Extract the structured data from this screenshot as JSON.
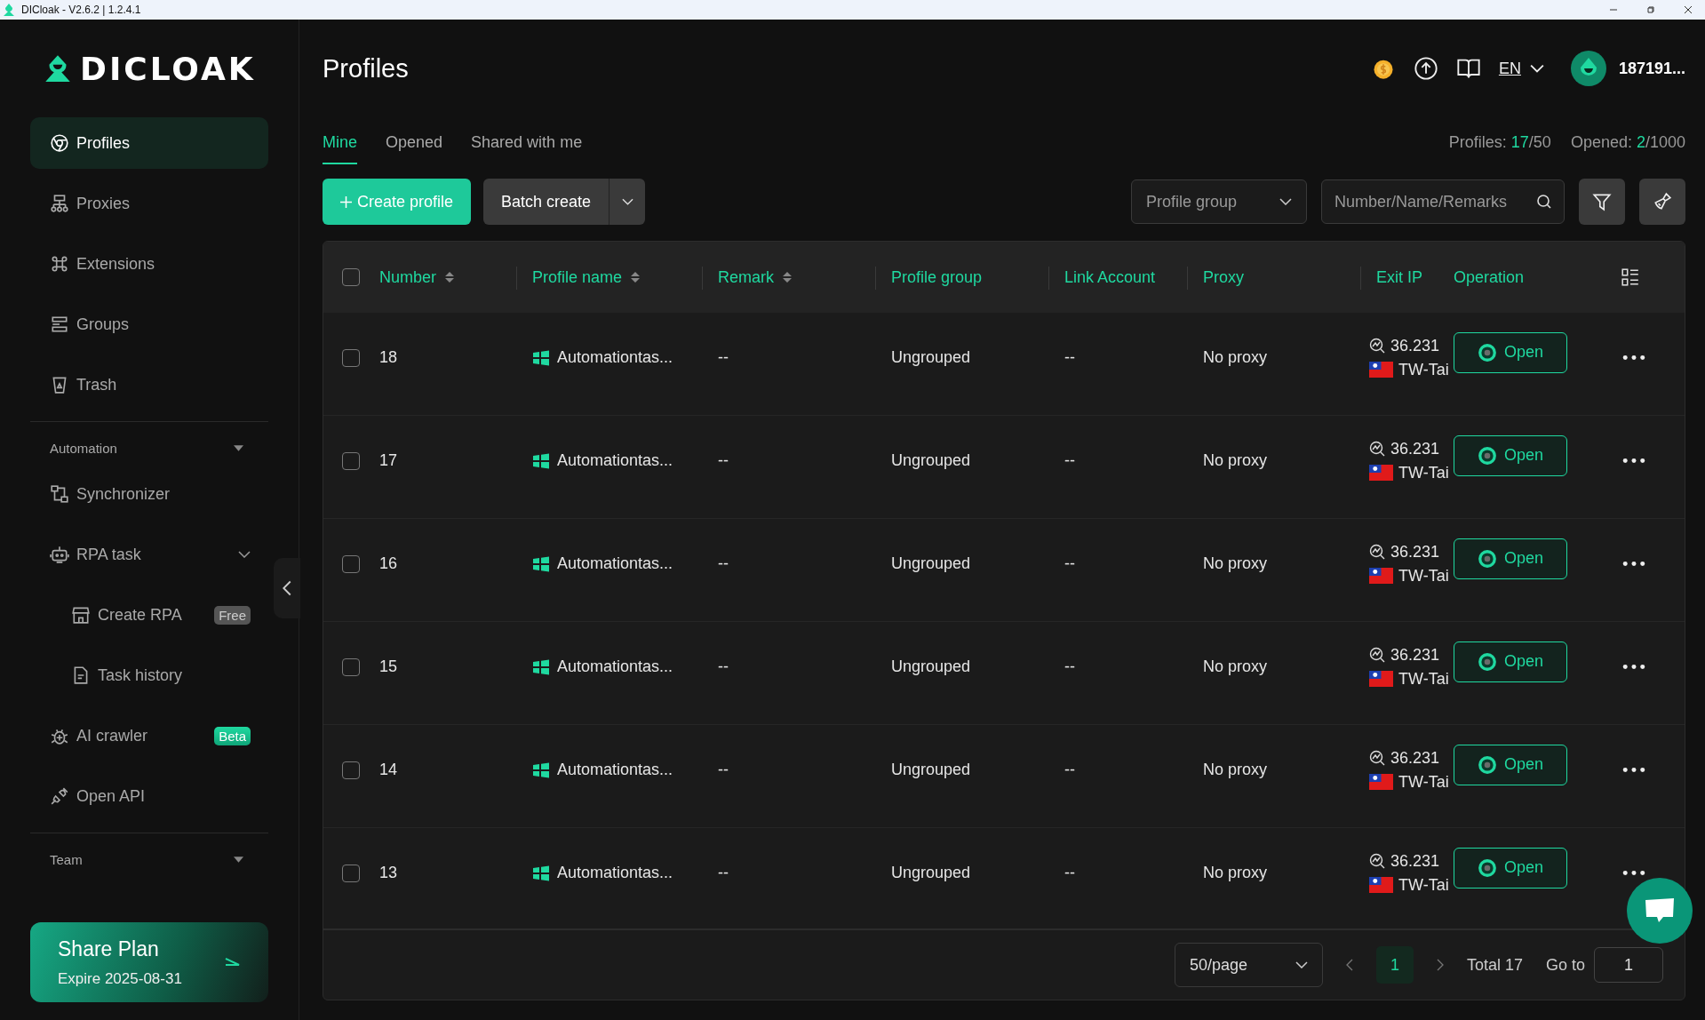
{
  "window": {
    "title": "DICloak - V2.6.2 | 1.2.4.1"
  },
  "sidebar": {
    "logo": "DICLOAK",
    "nav": [
      {
        "label": "Profiles",
        "selected": true
      },
      {
        "label": "Proxies",
        "selected": false
      },
      {
        "label": "Extensions",
        "selected": false
      },
      {
        "label": "Groups",
        "selected": false
      },
      {
        "label": "Trash",
        "selected": false
      }
    ],
    "automation": {
      "heading": "Automation",
      "items": [
        {
          "label": "Synchronizer",
          "kind": "item"
        },
        {
          "label": "RPA task",
          "kind": "group",
          "expanded": true,
          "children": [
            {
              "label": "Create RPA",
              "badge": "Free"
            },
            {
              "label": "Task history"
            }
          ]
        },
        {
          "label": "AI crawler",
          "kind": "item",
          "badge": "Beta"
        },
        {
          "label": "Open API",
          "kind": "item"
        }
      ]
    },
    "team": {
      "heading": "Team"
    },
    "plan": {
      "title": "Share Plan",
      "expire": "Expire 2025-08-31"
    }
  },
  "header": {
    "title": "Profiles",
    "language": "EN",
    "user": "187191..."
  },
  "tabs": [
    {
      "label": "Mine",
      "selected": true
    },
    {
      "label": "Opened",
      "selected": false
    },
    {
      "label": "Shared with me",
      "selected": false
    }
  ],
  "stats": {
    "profiles_label": "Profiles:",
    "profiles_used": "17",
    "profiles_limit": "/50",
    "opened_label": "Opened:",
    "opened_used": "2",
    "opened_limit": "/1000"
  },
  "toolbar": {
    "create": "Create profile",
    "batch": "Batch create",
    "group_select": {
      "placeholder": "Profile group"
    },
    "search": {
      "placeholder": "Number/Name/Remarks"
    }
  },
  "table": {
    "all_checked": false,
    "columns": [
      {
        "label": "Number",
        "sortable": true
      },
      {
        "label": "Profile name",
        "sortable": true
      },
      {
        "label": "Remark",
        "sortable": true
      },
      {
        "label": "Profile group",
        "sortable": false
      },
      {
        "label": "Link Account",
        "sortable": false
      },
      {
        "label": "Proxy",
        "sortable": false
      },
      {
        "label": "Exit IP",
        "sortable": false
      },
      {
        "label": "Operation",
        "sortable": false
      }
    ],
    "rows": [
      {
        "checked": false,
        "number": "18",
        "name": "Automationtas...",
        "remark": "--",
        "group": "Ungrouped",
        "link": "--",
        "proxy": "No proxy",
        "ip": "36.231",
        "location": "TW-Tai",
        "action": "Open"
      },
      {
        "checked": false,
        "number": "17",
        "name": "Automationtas...",
        "remark": "--",
        "group": "Ungrouped",
        "link": "--",
        "proxy": "No proxy",
        "ip": "36.231",
        "location": "TW-Tai",
        "action": "Open"
      },
      {
        "checked": false,
        "number": "16",
        "name": "Automationtas...",
        "remark": "--",
        "group": "Ungrouped",
        "link": "--",
        "proxy": "No proxy",
        "ip": "36.231",
        "location": "TW-Tai",
        "action": "Open"
      },
      {
        "checked": false,
        "number": "15",
        "name": "Automationtas...",
        "remark": "--",
        "group": "Ungrouped",
        "link": "--",
        "proxy": "No proxy",
        "ip": "36.231",
        "location": "TW-Tai",
        "action": "Open"
      },
      {
        "checked": false,
        "number": "14",
        "name": "Automationtas...",
        "remark": "--",
        "group": "Ungrouped",
        "link": "--",
        "proxy": "No proxy",
        "ip": "36.231",
        "location": "TW-Tai",
        "action": "Open"
      },
      {
        "checked": false,
        "number": "13",
        "name": "Automationtas...",
        "remark": "--",
        "group": "Ungrouped",
        "link": "--",
        "proxy": "No proxy",
        "ip": "36.231",
        "location": "TW-Tai",
        "action": "Open"
      }
    ]
  },
  "pagination": {
    "page_size": "50/page",
    "pages": [
      {
        "label": "1",
        "selected": true
      }
    ],
    "total": "Total 17",
    "goto_label": "Go to",
    "goto_value": "1"
  }
}
